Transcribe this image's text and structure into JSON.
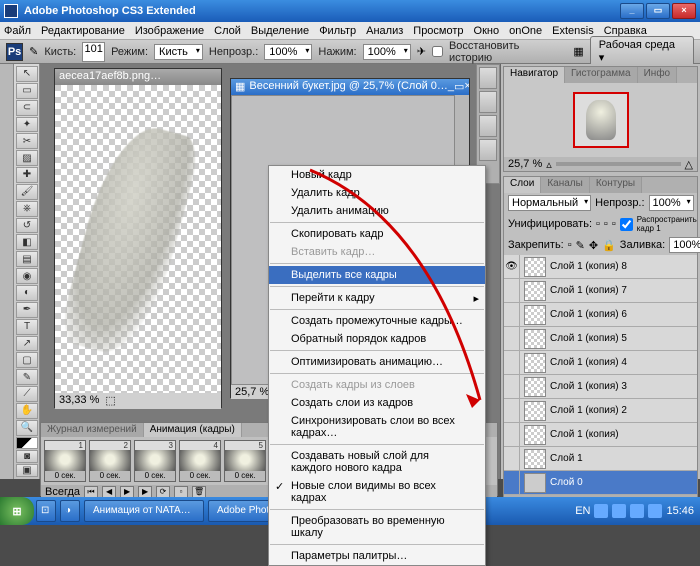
{
  "titlebar": {
    "title": "Adobe Photoshop CS3 Extended"
  },
  "menu": [
    "Файл",
    "Редактирование",
    "Изображение",
    "Слой",
    "Выделение",
    "Фильтр",
    "Анализ",
    "Просмотр",
    "Окно",
    "onOne",
    "Extensis",
    "Справка"
  ],
  "optbar": {
    "brush_label": "Кисть:",
    "brush_size": "101",
    "mode_label": "Режим:",
    "mode_value": "Кисть",
    "opacity_label": "Непрозр.:",
    "opacity_value": "100%",
    "press_label": "Нажим:",
    "press_value": "100%",
    "restore": "Восстановить историю",
    "workenv": "Рабочая среда"
  },
  "doc1": {
    "title": "aecea17aef8b.png…",
    "zoom": "33,33 %"
  },
  "doc2": {
    "title": "Весенний букет.jpg @ 25,7% (Слой 0…",
    "zoom": "25,7 %"
  },
  "ctx": {
    "new": "Новый кадр",
    "del": "Удалить кадр",
    "delanim": "Удалить анимацию",
    "copy": "Скопировать кадр",
    "paste": "Вставить кадр…",
    "selall": "Выделить все кадры",
    "goto": "Перейти к кадру",
    "tween": "Создать промежуточные кадры…",
    "reverse": "Обратный порядок кадров",
    "opt": "Оптимизировать анимацию…",
    "fromlayers": "Создать кадры из слоев",
    "tolayers": "Создать слои из кадров",
    "sync": "Синхронизировать слои во всех кадрах…",
    "newlayer": "Создавать новый слой для каждого нового кадра",
    "visible": "Новые слои видимы во всех кадрах",
    "totimeline": "Преобразовать во временную шкалу",
    "palopt": "Параметры палитры…"
  },
  "nav": {
    "tab1": "Навигатор",
    "tab2": "Гистограмма",
    "tab3": "Инфо",
    "zoom": "25,7 %"
  },
  "layers": {
    "tab1": "Слои",
    "tab2": "Каналы",
    "tab3": "Контуры",
    "blend": "Нормальный",
    "op_label": "Непрозр.:",
    "op_val": "100%",
    "unify": "Унифицировать:",
    "propagate": "Распространить кадр 1",
    "lock": "Закрепить:",
    "fill_label": "Заливка:",
    "fill_val": "100%",
    "items": [
      "Слой 1 (копия) 8",
      "Слой 1 (копия) 7",
      "Слой 1 (копия) 6",
      "Слой 1 (копия) 5",
      "Слой 1 (копия) 4",
      "Слой 1 (копия) 3",
      "Слой 1 (копия) 2",
      "Слой 1 (копия)",
      "Слой 1",
      "Слой 0"
    ],
    "selected": 9
  },
  "anim": {
    "tab1": "Журнал измерений",
    "tab2": "Анимация (кадры)",
    "count": 9,
    "selected": 9,
    "delay": "0 сек.",
    "loop": "Всегда"
  },
  "taskbar": {
    "items": [
      "Анимация от NATALI…",
      "Adobe Photoshop CS…"
    ],
    "lang": "EN",
    "time": "15:46"
  }
}
